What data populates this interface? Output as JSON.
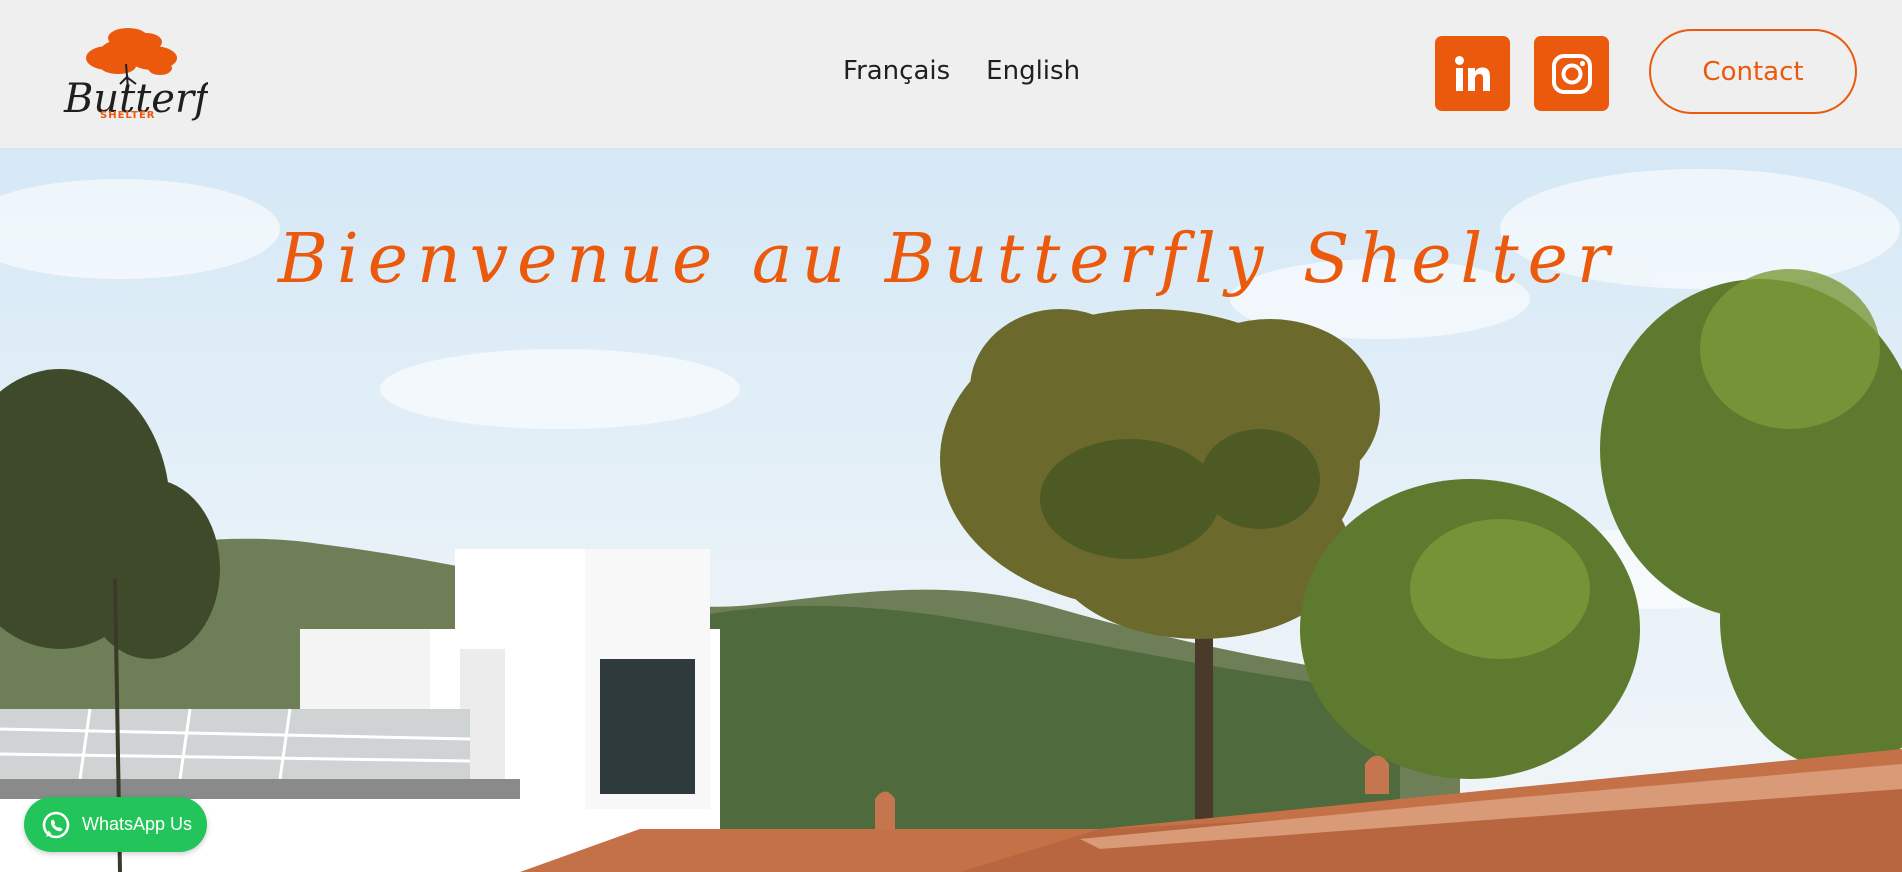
{
  "brand": {
    "logo_word": "Butterfly",
    "logo_sub": "SHELTER"
  },
  "nav": {
    "items": [
      {
        "label": "Français"
      },
      {
        "label": "English"
      }
    ]
  },
  "social": {
    "linkedin_icon": "linkedin-icon",
    "instagram_icon": "instagram-icon"
  },
  "header": {
    "contact_label": "Contact"
  },
  "hero": {
    "title": "Bienvenue au Butterfly Shelter"
  },
  "whatsapp": {
    "label": "WhatsApp Us"
  },
  "colors": {
    "accent": "#eb5a0c",
    "whatsapp": "#23c45a",
    "header_bg": "#efefef"
  }
}
